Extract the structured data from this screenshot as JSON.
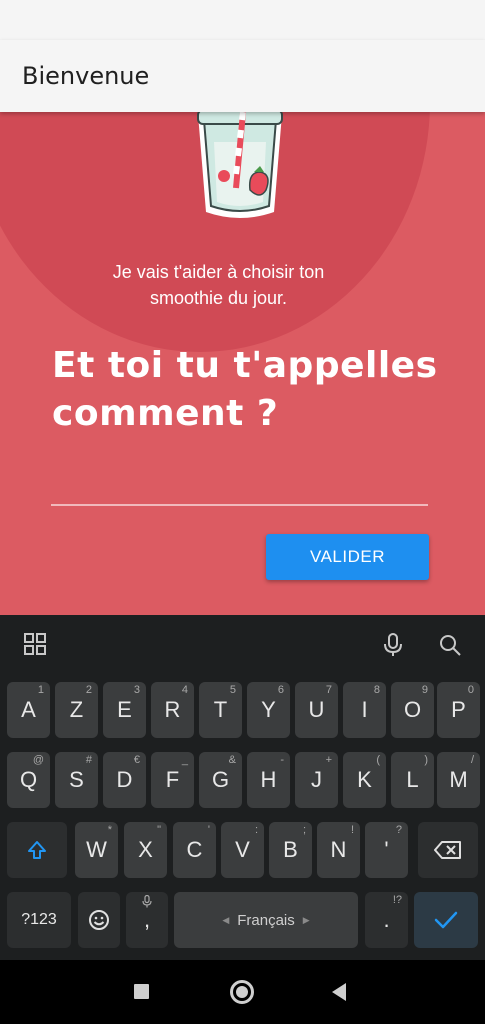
{
  "app_bar": {
    "title": "Bienvenue"
  },
  "content": {
    "intro_line1": "Je vais t'aider à choisir ton",
    "intro_line2": "smoothie du jour.",
    "question_line1": "Et toi tu t'appelles",
    "question_line2": "comment ?",
    "name_input_value": "",
    "validate_label": "VALIDER",
    "colors": {
      "background": "#dc5b62",
      "button": "#1e8ff0"
    }
  },
  "keyboard": {
    "row1": [
      {
        "label": "A",
        "hint": "1"
      },
      {
        "label": "Z",
        "hint": "2"
      },
      {
        "label": "E",
        "hint": "3"
      },
      {
        "label": "R",
        "hint": "4"
      },
      {
        "label": "T",
        "hint": "5"
      },
      {
        "label": "Y",
        "hint": "6"
      },
      {
        "label": "U",
        "hint": "7"
      },
      {
        "label": "I",
        "hint": "8"
      },
      {
        "label": "O",
        "hint": "9"
      },
      {
        "label": "P",
        "hint": "0"
      }
    ],
    "row2": [
      {
        "label": "Q",
        "hint": "@"
      },
      {
        "label": "S",
        "hint": "#"
      },
      {
        "label": "D",
        "hint": "€"
      },
      {
        "label": "F",
        "hint": "_"
      },
      {
        "label": "G",
        "hint": "&"
      },
      {
        "label": "H",
        "hint": "-"
      },
      {
        "label": "J",
        "hint": "+"
      },
      {
        "label": "K",
        "hint": "("
      },
      {
        "label": "L",
        "hint": ")"
      },
      {
        "label": "M",
        "hint": "/"
      }
    ],
    "row3": [
      {
        "label": "W",
        "hint": "*"
      },
      {
        "label": "X",
        "hint": "\""
      },
      {
        "label": "C",
        "hint": "'"
      },
      {
        "label": "V",
        "hint": ":"
      },
      {
        "label": "B",
        "hint": ";"
      },
      {
        "label": "N",
        "hint": "!"
      },
      {
        "label": "'",
        "hint": "?"
      }
    ],
    "symbols_label": "?123",
    "comma_label": ",",
    "space_label": "Français",
    "period_label": ".",
    "period_hint": "!?"
  }
}
